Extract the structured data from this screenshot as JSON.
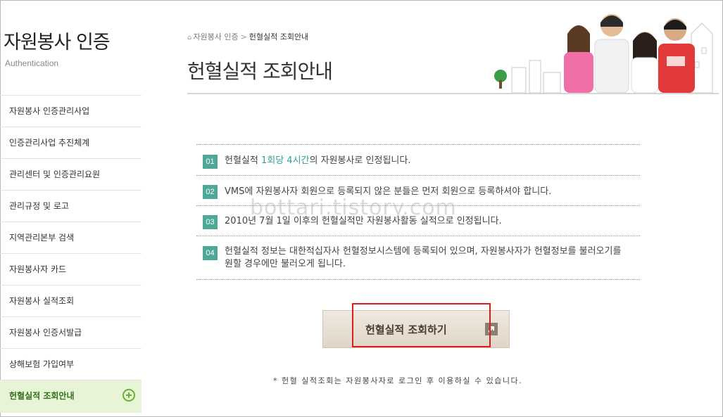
{
  "sidebar": {
    "title": "자원봉사 인증",
    "subtitle": "Authentication",
    "items": [
      {
        "label": "자원봉사 인증관리사업"
      },
      {
        "label": "인증관리사업 추진체계"
      },
      {
        "label": "관리센터 및 인증관리요원"
      },
      {
        "label": "관리규정 및 로고"
      },
      {
        "label": "지역관리본부 검색"
      },
      {
        "label": "자원봉사자 카드"
      },
      {
        "label": "자원봉사 실적조회"
      },
      {
        "label": "자원봉사 인증서발급"
      },
      {
        "label": "상해보험 가입여부"
      },
      {
        "label": "헌혈실적 조회안내"
      }
    ],
    "active_index": 9
  },
  "breadcrumb": {
    "parent": "자원봉사 인증",
    "current": "헌혈실적 조회안내"
  },
  "page_title": "헌혈실적 조회안내",
  "notices": [
    {
      "num": "01",
      "pre": "헌혈실적 ",
      "highlight": "1회당 4시간",
      "post": "의 자원봉사로 인정됩니다."
    },
    {
      "num": "02",
      "text": "VMS에 자원봉사자 회원으로 등록되지 않은 분들은 먼저 회원으로 등록하셔야 합니다."
    },
    {
      "num": "03",
      "text": "2010년 7월 1일 이후의 헌혈실적만 자원봉사활동 실적으로 인정됩니다."
    },
    {
      "num": "04",
      "line1": "헌혈실적 정보는 대한적십자사 헌혈정보시스템에 등록되어 있으며, 자원봉사자가 헌혈정보를 불러오기를",
      "line2": "원할 경우에만 불러오게 됩니다."
    }
  ],
  "watermark": "bottari.tistory.com",
  "button": {
    "label": "헌혈실적 조회하기"
  },
  "footnote": "* 헌혈 실적조회는 자원봉사자로 로그인 후 이용하실 수 있습니다.",
  "colors": {
    "accent": "#4ea89a",
    "highlight": "#35a095",
    "active_bg": "#e8f4d6",
    "red_box": "#e21c1c"
  }
}
